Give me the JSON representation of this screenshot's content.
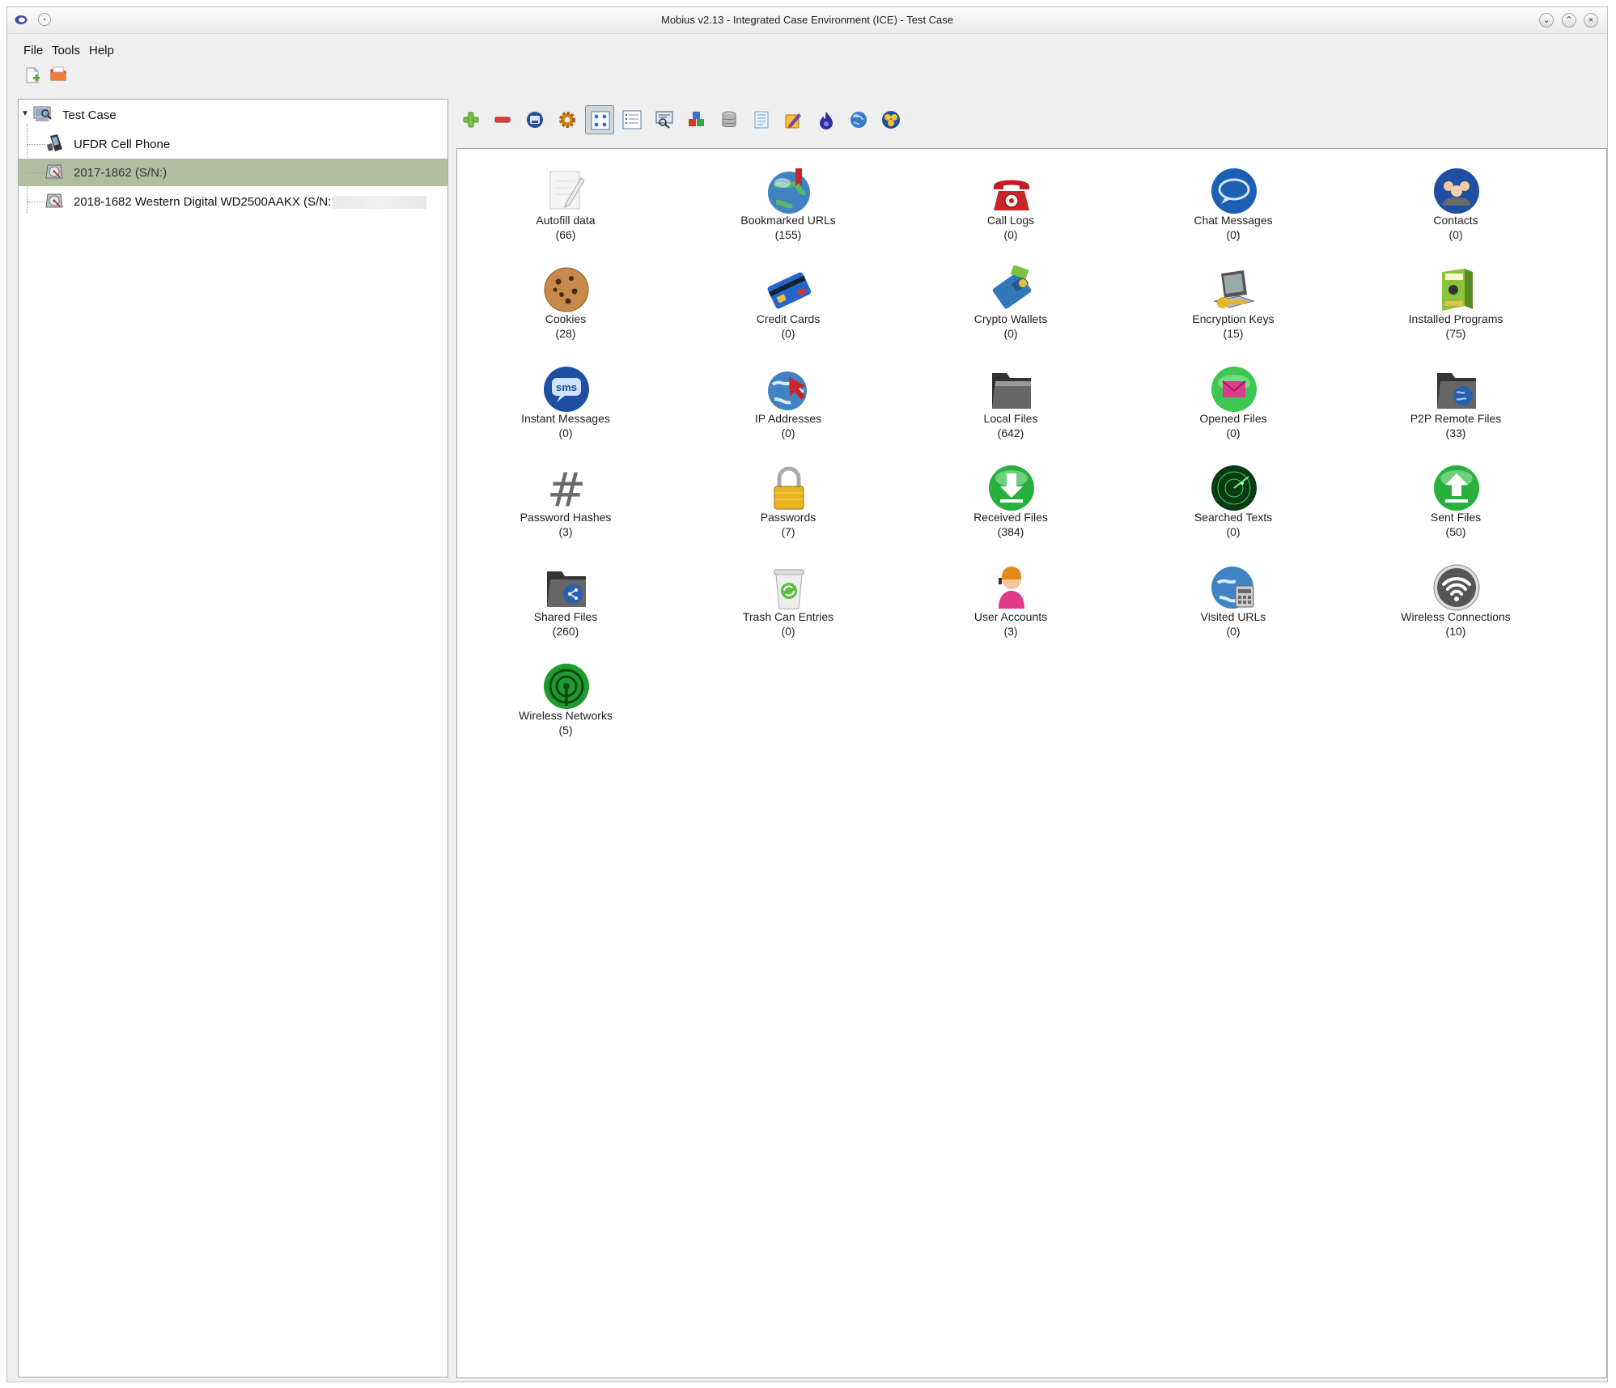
{
  "window": {
    "title": "Mobius v2.13 - Integrated Case Environment (ICE) - Test Case",
    "controls": [
      "minimize",
      "maximize",
      "close"
    ]
  },
  "menubar": {
    "items": [
      "File",
      "Tools",
      "Help"
    ]
  },
  "toolbar_top": {
    "icons": [
      "new-case-icon",
      "open-case-icon"
    ]
  },
  "tree": {
    "root": "Test Case",
    "items": [
      {
        "label": "UFDR Cell Phone",
        "icon": "phone-icon",
        "selected": false
      },
      {
        "label": "2017-1862   (S/N:)",
        "icon": "disk-icon",
        "selected": true
      },
      {
        "label": "2018-1682 Western Digital WD2500AAKX (S/N:",
        "icon": "disk-icon",
        "selected": false
      }
    ]
  },
  "toolbar_main": {
    "icons": [
      "add-icon",
      "remove-icon",
      "disk-save-icon",
      "settings-gear-icon",
      "icon-view-icon",
      "list-view-icon",
      "search-report-icon",
      "blocks-icon",
      "database-icon",
      "notes-icon",
      "pen-report-icon",
      "flame-icon",
      "globe-icon",
      "network-icon"
    ],
    "active_index": 4
  },
  "categories": [
    {
      "name": "Autofill data",
      "count": "(66)",
      "icon": "autofill-icon"
    },
    {
      "name": "Bookmarked URLs",
      "count": "(155)",
      "icon": "bookmark-globe-icon"
    },
    {
      "name": "Call Logs",
      "count": "(0)",
      "icon": "telephone-icon"
    },
    {
      "name": "Chat Messages",
      "count": "(0)",
      "icon": "chat-bubble-icon"
    },
    {
      "name": "Contacts",
      "count": "(0)",
      "icon": "contacts-icon"
    },
    {
      "name": "Cookies",
      "count": "(28)",
      "icon": "cookie-icon"
    },
    {
      "name": "Credit Cards",
      "count": "(0)",
      "icon": "credit-card-icon"
    },
    {
      "name": "Crypto Wallets",
      "count": "(0)",
      "icon": "wallet-icon"
    },
    {
      "name": "Encryption Keys",
      "count": "(15)",
      "icon": "key-laptop-icon"
    },
    {
      "name": "Installed Programs",
      "count": "(75)",
      "icon": "software-box-icon"
    },
    {
      "name": "Instant Messages",
      "count": "(0)",
      "icon": "sms-icon"
    },
    {
      "name": "IP Addresses",
      "count": "(0)",
      "icon": "ip-globe-icon"
    },
    {
      "name": "Local Files",
      "count": "(642)",
      "icon": "folder-icon"
    },
    {
      "name": "Opened Files",
      "count": "(0)",
      "icon": "opened-mail-icon"
    },
    {
      "name": "P2P Remote Files",
      "count": "(33)",
      "icon": "p2p-folder-icon"
    },
    {
      "name": "Password Hashes",
      "count": "(3)",
      "icon": "hash-icon"
    },
    {
      "name": "Passwords",
      "count": "(7)",
      "icon": "padlock-icon"
    },
    {
      "name": "Received Files",
      "count": "(384)",
      "icon": "download-icon"
    },
    {
      "name": "Searched Texts",
      "count": "(0)",
      "icon": "radar-icon"
    },
    {
      "name": "Sent Files",
      "count": "(50)",
      "icon": "upload-icon"
    },
    {
      "name": "Shared Files",
      "count": "(260)",
      "icon": "shared-folder-icon"
    },
    {
      "name": "Trash Can Entries",
      "count": "(0)",
      "icon": "trash-can-icon"
    },
    {
      "name": "User Accounts",
      "count": "(3)",
      "icon": "user-icon"
    },
    {
      "name": "Visited URLs",
      "count": "(0)",
      "icon": "visited-globe-icon"
    },
    {
      "name": "Wireless Connections",
      "count": "(10)",
      "icon": "wifi-icon"
    },
    {
      "name": "Wireless Networks",
      "count": "(5)",
      "icon": "antenna-icon"
    }
  ]
}
